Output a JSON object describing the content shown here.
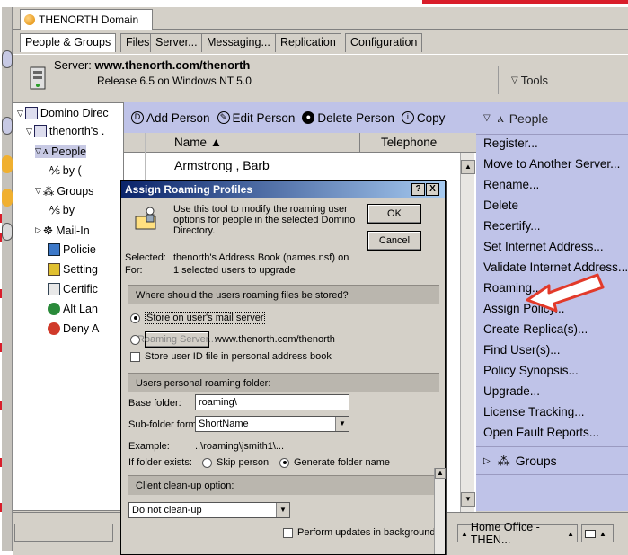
{
  "window": {
    "domain_tab": "THENORTH Domain",
    "tabs": [
      "People & Groups",
      "Files",
      "Server...",
      "Messaging...",
      "Replication",
      "Configuration"
    ],
    "server_prefix": "Server:",
    "server_name": "www.thenorth.com/thenorth",
    "release": "Release 6.5 on Windows NT 5.0",
    "tools_label": "Tools"
  },
  "tree": {
    "items": [
      "Domino Direc",
      "thenorth's .",
      "People",
      "by (",
      "Groups",
      "by",
      "Mail-In",
      "Policie",
      "Setting",
      "Certific",
      "Alt Lan",
      "Deny A"
    ]
  },
  "view": {
    "toolbar": [
      "Add Person",
      "Edit Person",
      "Delete Person",
      "Copy"
    ],
    "columns": [
      "Name ▲",
      "Telephone"
    ],
    "rows": [
      "Armstrong , Barb"
    ]
  },
  "actions": {
    "people_header": "People",
    "items": [
      "Register...",
      "Move to Another Server...",
      "Rename...",
      "Delete",
      "Recertify...",
      "Set Internet Address...",
      "Validate Internet Address...",
      "Roaming...",
      "Assign Policy...",
      "Create Replica(s)...",
      "Find User(s)...",
      "Policy Synopsis...",
      "Upgrade...",
      "License Tracking...",
      "Open Fault Reports..."
    ],
    "groups_header": "Groups"
  },
  "status": {
    "location": "Home Office - THEN..."
  },
  "dialog": {
    "title": "Assign Roaming Profiles",
    "help": "?",
    "close": "X",
    "intro": [
      "Use this tool to modify the roaming user",
      "options for people in the selected Domino",
      "Directory."
    ],
    "ok": "OK",
    "cancel": "Cancel",
    "selected_label": "Selected:",
    "selected_value": "thenorth's Address Book (names.nsf) on",
    "for_label": "For:",
    "for_value": "1 selected users to upgrade",
    "section_store": "Where should the users roaming files be stored?",
    "opt_mail": "Store on user's mail server",
    "roaming_server_btn": "Roaming Server...",
    "roaming_server_value": "www.thenorth.com/thenorth",
    "store_id": "Store user ID file in personal address book",
    "section_folder": "Users personal roaming folder:",
    "base_folder_label": "Base folder:",
    "base_folder_value": "roaming\\",
    "subfolder_label": "Sub-folder format:",
    "subfolder_value": "ShortName",
    "example_label": "Example:",
    "example_value": "..\\roaming\\jsmith1\\...",
    "exists_label": "If folder exists:",
    "skip_person": "Skip person",
    "generate_name": "Generate folder name",
    "section_cleanup": "Client clean-up option:",
    "cleanup_value": "Do not clean-up",
    "background": "Perform updates in background"
  },
  "colors": {
    "accent_red": "#d91d2a",
    "action_panel": "#bfc3e8",
    "title_bar": "#0a246a"
  }
}
